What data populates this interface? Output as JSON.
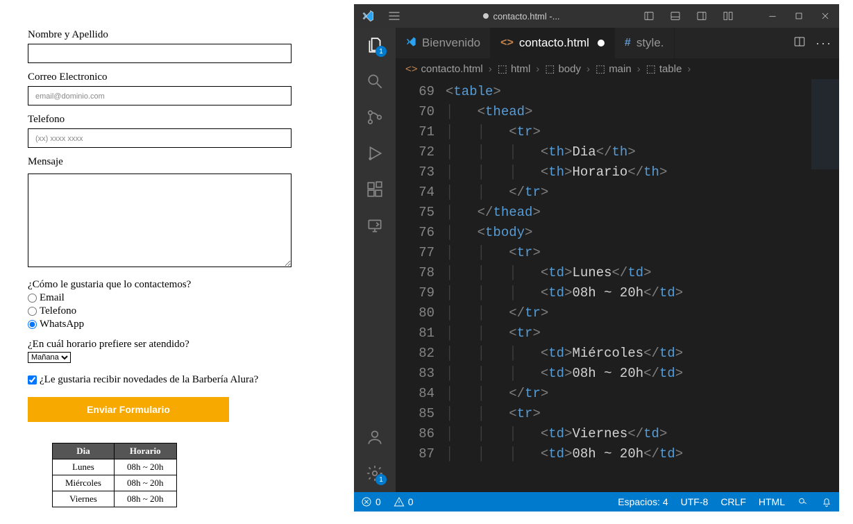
{
  "form": {
    "name_label": "Nombre y Apellido",
    "email_label": "Correo Electronico",
    "email_placeholder": "email@dominio.com",
    "phone_label": "Telefono",
    "phone_placeholder": "(xx) xxxx xxxx",
    "message_label": "Mensaje",
    "contact_question": "¿Cómo le gustaria que lo contactemos?",
    "radio_email": "Email",
    "radio_phone": "Telefono",
    "radio_whatsapp": "WhatsApp",
    "time_question": "¿En cuál horario prefiere ser atendido?",
    "time_option": "Mañana",
    "newsletter_question": "¿Le gustaria recibir novedades de la Barbería Alura?",
    "submit_label": "Enviar Formulario"
  },
  "schedule": {
    "header_day": "Dia",
    "header_hours": "Horario",
    "rows": [
      {
        "day": "Lunes",
        "hours": "08h ~ 20h"
      },
      {
        "day": "Miércoles",
        "hours": "08h ~ 20h"
      },
      {
        "day": "Viernes",
        "hours": "08h ~ 20h"
      }
    ]
  },
  "vscode": {
    "window_title": "contacto.html -...",
    "tabs": {
      "welcome": "Bienvenido",
      "active_file": "contacto.html",
      "style_file": "style."
    },
    "breadcrumb": [
      "contacto.html",
      "html",
      "body",
      "main",
      "table"
    ],
    "statusbar": {
      "errors": "0",
      "warnings": "0",
      "spaces": "Espacios: 4",
      "encoding": "UTF-8",
      "eol": "CRLF",
      "language": "HTML"
    },
    "activitybar": {
      "explorer_badge": "1",
      "settings_badge": "1"
    },
    "code": {
      "lines": [
        {
          "n": 69,
          "indent": 0,
          "kind": "open",
          "tag": "table"
        },
        {
          "n": 70,
          "indent": 1,
          "kind": "open",
          "tag": "thead"
        },
        {
          "n": 71,
          "indent": 2,
          "kind": "open",
          "tag": "tr"
        },
        {
          "n": 72,
          "indent": 3,
          "kind": "pair",
          "tag": "th",
          "text": "Dia"
        },
        {
          "n": 73,
          "indent": 3,
          "kind": "pair",
          "tag": "th",
          "text": "Horario"
        },
        {
          "n": 74,
          "indent": 2,
          "kind": "close",
          "tag": "tr"
        },
        {
          "n": 75,
          "indent": 1,
          "kind": "close",
          "tag": "thead"
        },
        {
          "n": 76,
          "indent": 1,
          "kind": "open",
          "tag": "tbody"
        },
        {
          "n": 77,
          "indent": 2,
          "kind": "open",
          "tag": "tr"
        },
        {
          "n": 78,
          "indent": 3,
          "kind": "pair",
          "tag": "td",
          "text": "Lunes"
        },
        {
          "n": 79,
          "indent": 3,
          "kind": "pair",
          "tag": "td",
          "text": "08h ~ 20h"
        },
        {
          "n": 80,
          "indent": 2,
          "kind": "close",
          "tag": "tr"
        },
        {
          "n": 81,
          "indent": 2,
          "kind": "open",
          "tag": "tr"
        },
        {
          "n": 82,
          "indent": 3,
          "kind": "pair",
          "tag": "td",
          "text": "Miércoles"
        },
        {
          "n": 83,
          "indent": 3,
          "kind": "pair",
          "tag": "td",
          "text": "08h ~ 20h"
        },
        {
          "n": 84,
          "indent": 2,
          "kind": "close",
          "tag": "tr"
        },
        {
          "n": 85,
          "indent": 2,
          "kind": "open",
          "tag": "tr"
        },
        {
          "n": 86,
          "indent": 3,
          "kind": "pair",
          "tag": "td",
          "text": "Viernes"
        },
        {
          "n": 87,
          "indent": 3,
          "kind": "pair",
          "tag": "td",
          "text": "08h ~ 20h"
        }
      ]
    }
  }
}
